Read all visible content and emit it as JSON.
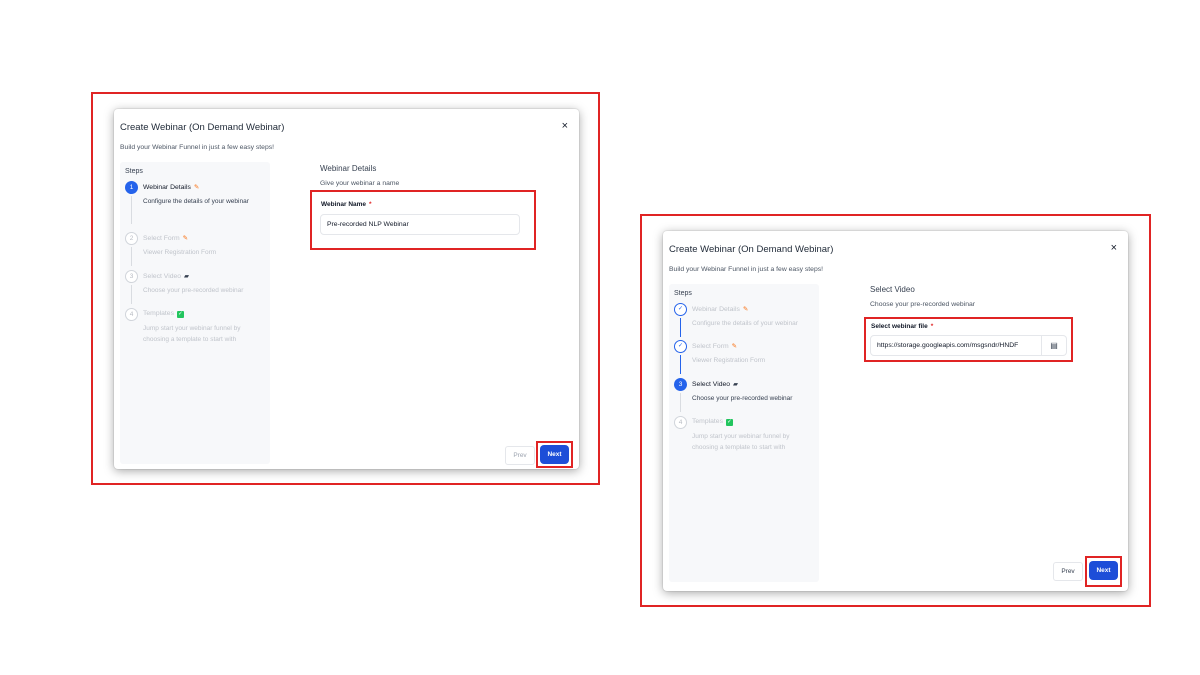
{
  "screen1": {
    "modal": {
      "title": "Create Webinar (On Demand Webinar)",
      "subtitle": "Build your Webinar Funnel in just a few easy steps!",
      "close_glyph": "×"
    },
    "steps_heading": "Steps",
    "steps": [
      {
        "number": "1",
        "title": "Webinar Details",
        "description": "Configure the details of your webinar",
        "state": "active",
        "icon": "pencil-icon"
      },
      {
        "number": "2",
        "title": "Select Form",
        "description": "Viewer Registration Form",
        "state": "pending",
        "icon": "pencil-icon"
      },
      {
        "number": "3",
        "title": "Select Video",
        "description": "Choose your pre-recorded webinar",
        "state": "pending",
        "icon": "camera-icon"
      },
      {
        "number": "4",
        "title": "Templates",
        "description": "Jump start your webinar funnel by choosing a template to start with",
        "state": "pending",
        "icon": "check-icon"
      }
    ],
    "section_title": "Webinar Details",
    "section_subtitle": "Give your webinar a name",
    "field": {
      "label": "Webinar Name",
      "required_mark": "*",
      "value": "Pre-recorded NLP Webinar"
    },
    "prev_label": "Prev",
    "next_label": "Next"
  },
  "screen2": {
    "modal": {
      "title": "Create Webinar (On Demand Webinar)",
      "subtitle": "Build your Webinar Funnel in just a few easy steps!",
      "close_glyph": "×"
    },
    "steps_heading": "Steps",
    "steps": [
      {
        "number": "✓",
        "title": "Webinar Details",
        "description": "Configure the details of your webinar",
        "state": "done",
        "icon": "pencil-icon"
      },
      {
        "number": "✓",
        "title": "Select Form",
        "description": "Viewer Registration Form",
        "state": "done",
        "icon": "pencil-icon"
      },
      {
        "number": "3",
        "title": "Select Video",
        "description": "Choose your pre-recorded webinar",
        "state": "active",
        "icon": "camera-icon"
      },
      {
        "number": "4",
        "title": "Templates",
        "description": "Jump start your webinar funnel by choosing a template to start with",
        "state": "pending",
        "icon": "check-icon"
      }
    ],
    "section_title": "Select Video",
    "section_subtitle": "Choose your pre-recorded webinar",
    "field": {
      "label": "Select webinar file",
      "required_mark": "*",
      "value": "https://storage.googleapis.com/msgsndr/HNDF"
    },
    "picker_icon": "file-picker-icon",
    "prev_label": "Prev",
    "next_label": "Next"
  },
  "colors": {
    "highlight": "#e02424",
    "primary": "#1d4ed8",
    "accent_pencil": "#f97316",
    "accent_check": "#22c55e"
  }
}
